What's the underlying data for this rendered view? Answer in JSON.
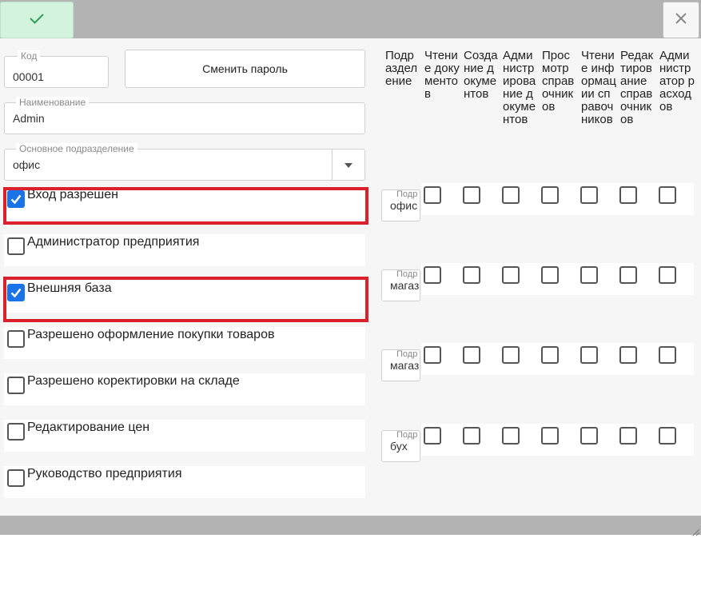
{
  "window": {
    "ok_icon": "check-icon",
    "close_icon": "close-icon",
    "accent": "#1a73e8",
    "highlight_color": "#d9202c"
  },
  "form": {
    "code": {
      "label": "Код",
      "value": "00001"
    },
    "change_password_label": "Сменить пароль",
    "name": {
      "label": "Наименование",
      "value": "Admin"
    },
    "department": {
      "label": "Основное подразделение",
      "value": "офис"
    }
  },
  "permissions": [
    {
      "label": "Вход разрешен",
      "checked": true
    },
    {
      "label": "Администратор предприятия",
      "checked": false
    },
    {
      "label": "Внешняя база",
      "checked": true
    },
    {
      "label": "Разрешено оформление покупки товаров",
      "checked": false
    },
    {
      "label": "Разрешено коректировки на складе",
      "checked": false
    },
    {
      "label": "Редактирование цен",
      "checked": false
    },
    {
      "label": "Руководство предприятия",
      "checked": false
    }
  ],
  "grid": {
    "columns": [
      "Подразделение",
      "Чтение документов",
      "Создание документов",
      "Администрирование документов",
      "Просмотр справочников",
      "Чтение информации справочников",
      "Редактирование справочников",
      "Администратор расходов"
    ],
    "rows": [
      {
        "sub_label": "Подр",
        "department": "офис"
      },
      {
        "sub_label": "Подр",
        "department": "магазин"
      },
      {
        "sub_label": "Подр",
        "department": "магазин"
      },
      {
        "sub_label": "Подр",
        "department": "бух"
      }
    ]
  }
}
